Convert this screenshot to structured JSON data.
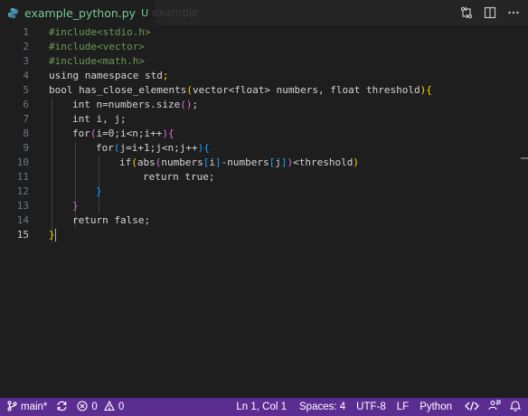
{
  "tab": {
    "filename": "example_python.py",
    "status": "U",
    "ghost": "example"
  },
  "editor": {
    "lines": [
      {
        "n": "1"
      },
      {
        "n": "2"
      },
      {
        "n": "3"
      },
      {
        "n": "4"
      },
      {
        "n": "5"
      },
      {
        "n": "6"
      },
      {
        "n": "7"
      },
      {
        "n": "8"
      },
      {
        "n": "9"
      },
      {
        "n": "10"
      },
      {
        "n": "11"
      },
      {
        "n": "12"
      },
      {
        "n": "13"
      },
      {
        "n": "14"
      },
      {
        "n": "15"
      }
    ],
    "code": {
      "l1": "#include<stdio.h>",
      "l2": "#include<vector>",
      "l3": "#include<math.h>",
      "l4a": "using namespace std",
      "l4b": ";",
      "l5a": "bool has_close_elements",
      "l5b": "(",
      "l5c": "vector<float> numbers, float threshold",
      "l5d": ")",
      "l5e": "{",
      "l6a": "int n=numbers.size",
      "l6b": "()",
      "l6c": ";",
      "l7": "int i, j;",
      "l8a": "for",
      "l8b": "(",
      "l8c": "i=0;i<n;i++",
      "l8d": ")",
      "l8e": "{",
      "l9a": "for",
      "l9b": "(",
      "l9c": "j=i+1;j<n;j++",
      "l9d": ")",
      "l9e": "{",
      "l10a": "if",
      "l10b": "(",
      "l10c": "abs",
      "l10d": "(",
      "l10e": "numbers",
      "l10f": "[",
      "l10g": "i",
      "l10h": "]",
      "l10i": "-numbers",
      "l10j": "[",
      "l10k": "j",
      "l10l": "]",
      "l10m": ")",
      "l10n": "<threshold",
      "l10o": ")",
      "l11": "return true;",
      "l12": "}",
      "l13": "}",
      "l14": "return false;",
      "l15": "}"
    }
  },
  "status": {
    "branch": "main*",
    "errors": "0",
    "warnings": "0",
    "position": "Ln 1, Col 1",
    "spaces": "Spaces: 4",
    "encoding": "UTF-8",
    "eol": "LF",
    "language": "Python"
  },
  "colors": {
    "statusbar": "#5c2d91",
    "editor_bg": "#1e1e1e",
    "tab_text": "#73c991"
  }
}
